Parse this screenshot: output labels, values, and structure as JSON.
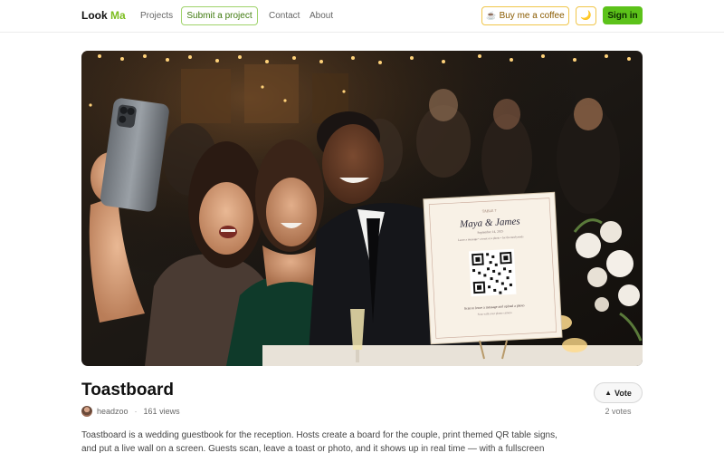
{
  "nav": {
    "logo_main": "Look",
    "logo_accent": "Ma",
    "projects": "Projects",
    "submit": "Submit a project",
    "contact": "Contact",
    "about": "About",
    "coffee": "Buy me a coffee",
    "coffee_icon": "☕",
    "moon_icon": "🌙",
    "signin": "Sign in"
  },
  "hero": {
    "sign_header": "TABLE 7",
    "sign_names": "Maya & James",
    "sign_date": "September 14, 2025",
    "sign_line": "Leave a message • a toast or a photo • for the newlyweds",
    "sign_cta": "Scan to leave a message and upload a photo",
    "sign_footer": "Scan with your phone camera"
  },
  "project": {
    "title": "Toastboard",
    "author": "headzoo",
    "views": "161 views",
    "vote_icon": "▲",
    "vote_label": "Vote",
    "votes": "2 votes",
    "description_1": "Toastboard is a wedding guestbook for the reception. Hosts create a board for the couple, print themed QR table signs,",
    "description_2": "and put a live wall on a screen. Guests scan, leave a toast or photo, and it shows up in real time — with a fullscreen"
  },
  "colors": {
    "accent": "#7cbd1f",
    "signin_bg": "#5cc21a",
    "coffee_border": "#f0c64a"
  }
}
